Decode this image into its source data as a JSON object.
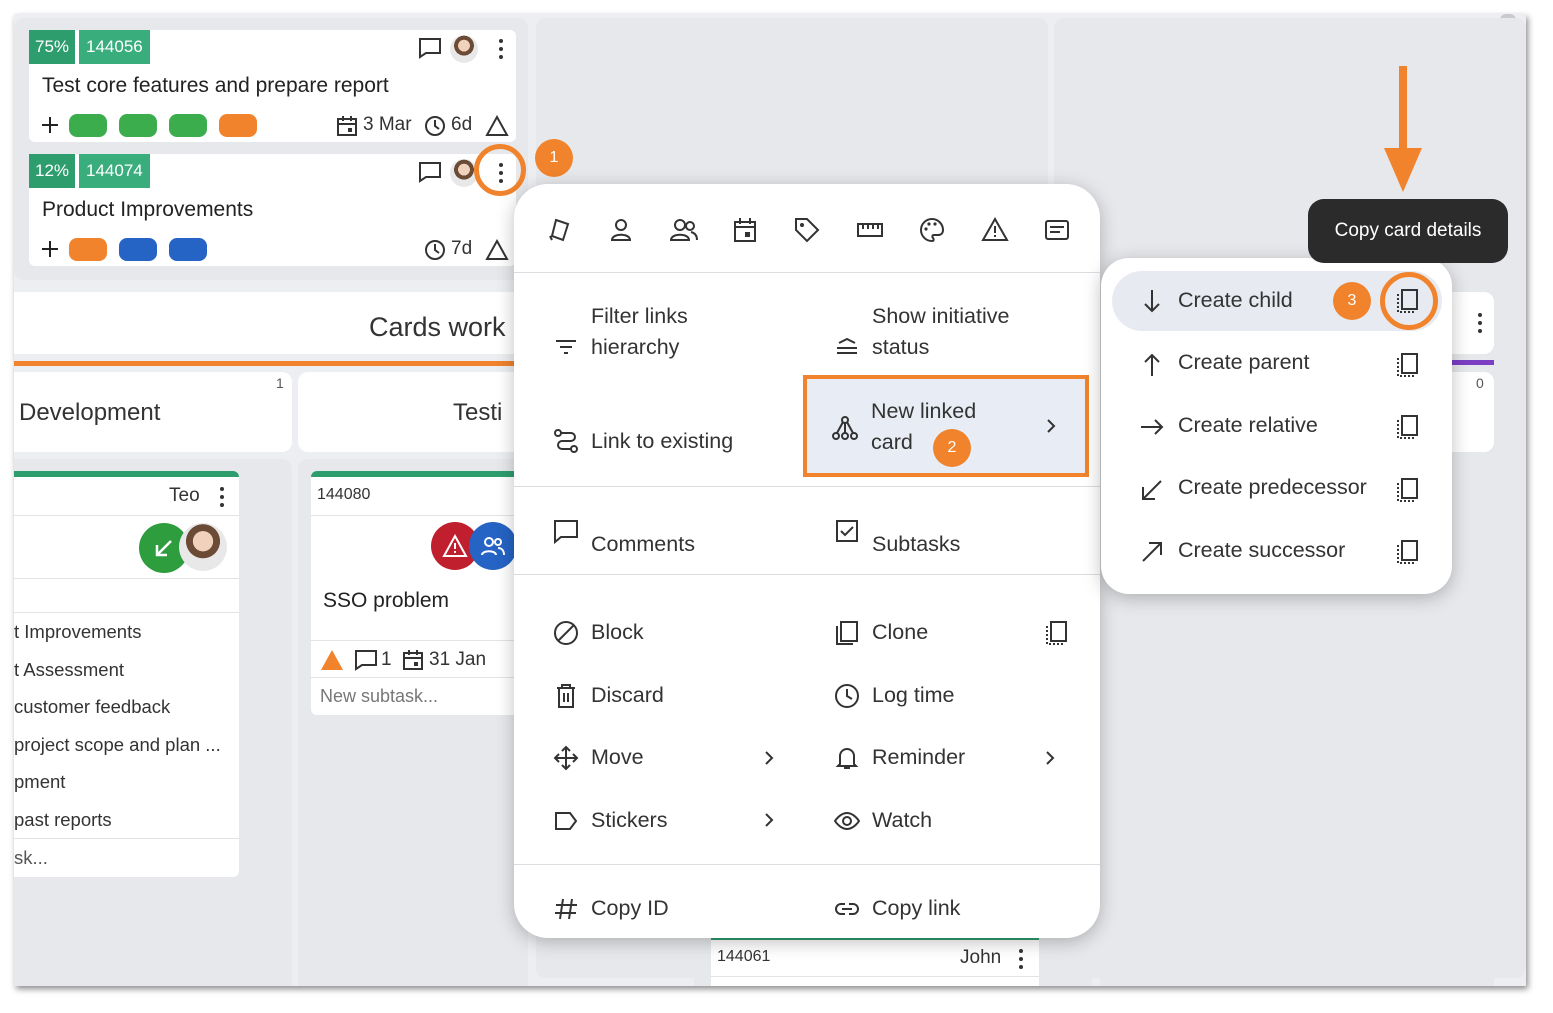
{
  "board": {
    "banner_title": "Cards work",
    "columns": [
      {
        "title": "Development",
        "count": "1"
      },
      {
        "title": "Testi",
        "count": ""
      },
      {
        "title": "",
        "count": "0"
      }
    ]
  },
  "cards": [
    {
      "percent": "75%",
      "id": "144056",
      "title": "Test core features and prepare report",
      "date": "3 Mar",
      "duration": "6d"
    },
    {
      "percent": "12%",
      "id": "144074",
      "title": "Product Improvements",
      "duration": "7d"
    }
  ],
  "dev_card": {
    "owner": "Teo",
    "rows": [
      "t Improvements",
      "t Assessment",
      "customer feedback",
      "project scope and plan ...",
      "pment",
      "past reports",
      "sk..."
    ]
  },
  "test_card": {
    "id": "144080",
    "title": "SSO problem",
    "comments": "1",
    "date": "31 Jan",
    "subtask_placeholder": "New subtask..."
  },
  "bottom_card": {
    "id": "144061",
    "owner": "John"
  },
  "menu": {
    "toolbar_icons": [
      "card-type-icon",
      "user-icon",
      "users-icon",
      "calendar-icon",
      "tag-icon",
      "ruler-icon",
      "palette-icon",
      "warning-icon",
      "description-icon"
    ],
    "filter_links": "Filter links hierarchy",
    "show_initiative": "Show initiative status",
    "link_existing": "Link to existing",
    "new_linked": "New linked card",
    "comments": "Comments",
    "subtasks": "Subtasks",
    "block": "Block",
    "clone": "Clone",
    "discard": "Discard",
    "log_time": "Log time",
    "move": "Move",
    "reminder": "Reminder",
    "stickers": "Stickers",
    "watch": "Watch",
    "copy_id": "Copy ID",
    "copy_link": "Copy link"
  },
  "submenu": {
    "items": [
      "Create child",
      "Create parent",
      "Create relative",
      "Create predecessor",
      "Create successor"
    ]
  },
  "tooltip": "Copy card details",
  "steps": [
    "1",
    "2",
    "3"
  ],
  "colors": {
    "accent": "#f0832c",
    "green": "#3aad7c",
    "blue": "#2563c4",
    "red": "#c0202d"
  }
}
